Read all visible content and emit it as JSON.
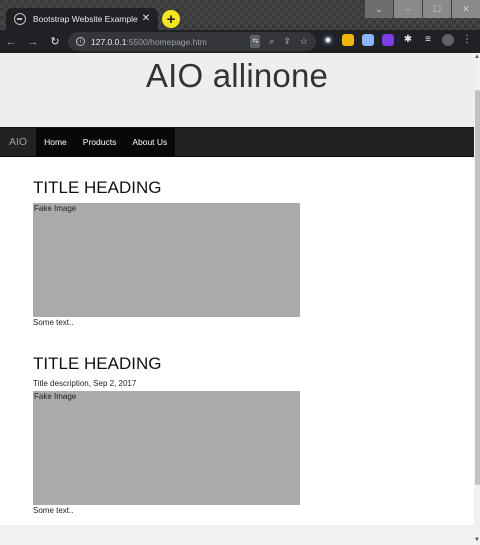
{
  "browser": {
    "tab_title": "Bootstrap Website Example",
    "tab_close": "✕",
    "newtab_label": "+",
    "url_host": "127.0.0.1",
    "url_path": ":5500/homepage.htm",
    "window_controls": [
      "⌄",
      "–",
      "☐",
      "✕"
    ],
    "icons": {
      "back": "back-arrow-icon",
      "forward": "forward-arrow-icon",
      "reload": "reload-icon",
      "info": "info-icon",
      "translate": "translate-icon",
      "zoom": "zoom-icon",
      "share": "share-icon",
      "bookmark": "star-icon"
    },
    "colors": {
      "tab_bg": "#202124",
      "newtab": "#f3e81d"
    }
  },
  "page": {
    "site_title": "AIO allinone",
    "nav": {
      "brand": "AIO",
      "items": [
        "Home",
        "Products",
        "About Us"
      ]
    },
    "posts": [
      {
        "heading": "TITLE HEADING",
        "description": "",
        "image_label": "Fake Image",
        "text": "Some text.."
      },
      {
        "heading": "TITLE HEADING",
        "description": "Title description, Sep 2, 2017",
        "image_label": "Fake Image",
        "text": "Some text.."
      }
    ],
    "colors": {
      "jumbotron": "#eeeeee",
      "navbar": "#222222",
      "image_placeholder": "#aaaaaa"
    }
  }
}
